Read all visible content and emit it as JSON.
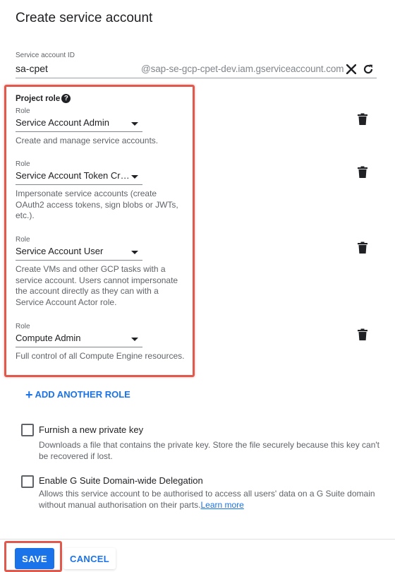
{
  "title": "Create service account",
  "service_account": {
    "label": "Service account ID",
    "value": "sa-cpet",
    "suffix": "@sap-se-gcp-cpet-dev.iam.gserviceaccount.com",
    "clear_icon": "close-icon",
    "refresh_icon": "refresh-icon"
  },
  "project_role": {
    "label": "Project role",
    "help_glyph": "?",
    "roles": [
      {
        "label": "Role",
        "value": "Service Account Admin",
        "description": "Create and manage service accounts."
      },
      {
        "label": "Role",
        "value": "Service Account Token Cr…",
        "description": "Impersonate service accounts (create OAuth2 access tokens, sign blobs or JWTs, etc.)."
      },
      {
        "label": "Role",
        "value": "Service Account User",
        "description": "Create VMs and other GCP tasks with a service account. Users cannot impersonate the account directly as they can with a Service Account Actor role."
      },
      {
        "label": "Role",
        "value": "Compute Admin",
        "description": "Full control of all Compute Engine resources."
      }
    ]
  },
  "add_role": {
    "plus": "+",
    "label": "ADD ANOTHER ROLE"
  },
  "options": {
    "private_key": {
      "label": "Furnish a new private key",
      "checked": false,
      "description": "Downloads a file that contains the private key. Store the file securely because this key can't be recovered if lost."
    },
    "delegation": {
      "label": "Enable G Suite Domain-wide Delegation",
      "checked": false,
      "description": "Allows this service account to be authorised to access all users' data on a G Suite domain without manual authorisation on their parts.",
      "link": "Learn more"
    }
  },
  "footer": {
    "save": "SAVE",
    "cancel": "CANCEL"
  },
  "colors": {
    "accent": "#1a73e8",
    "highlight": "#e0594c"
  }
}
